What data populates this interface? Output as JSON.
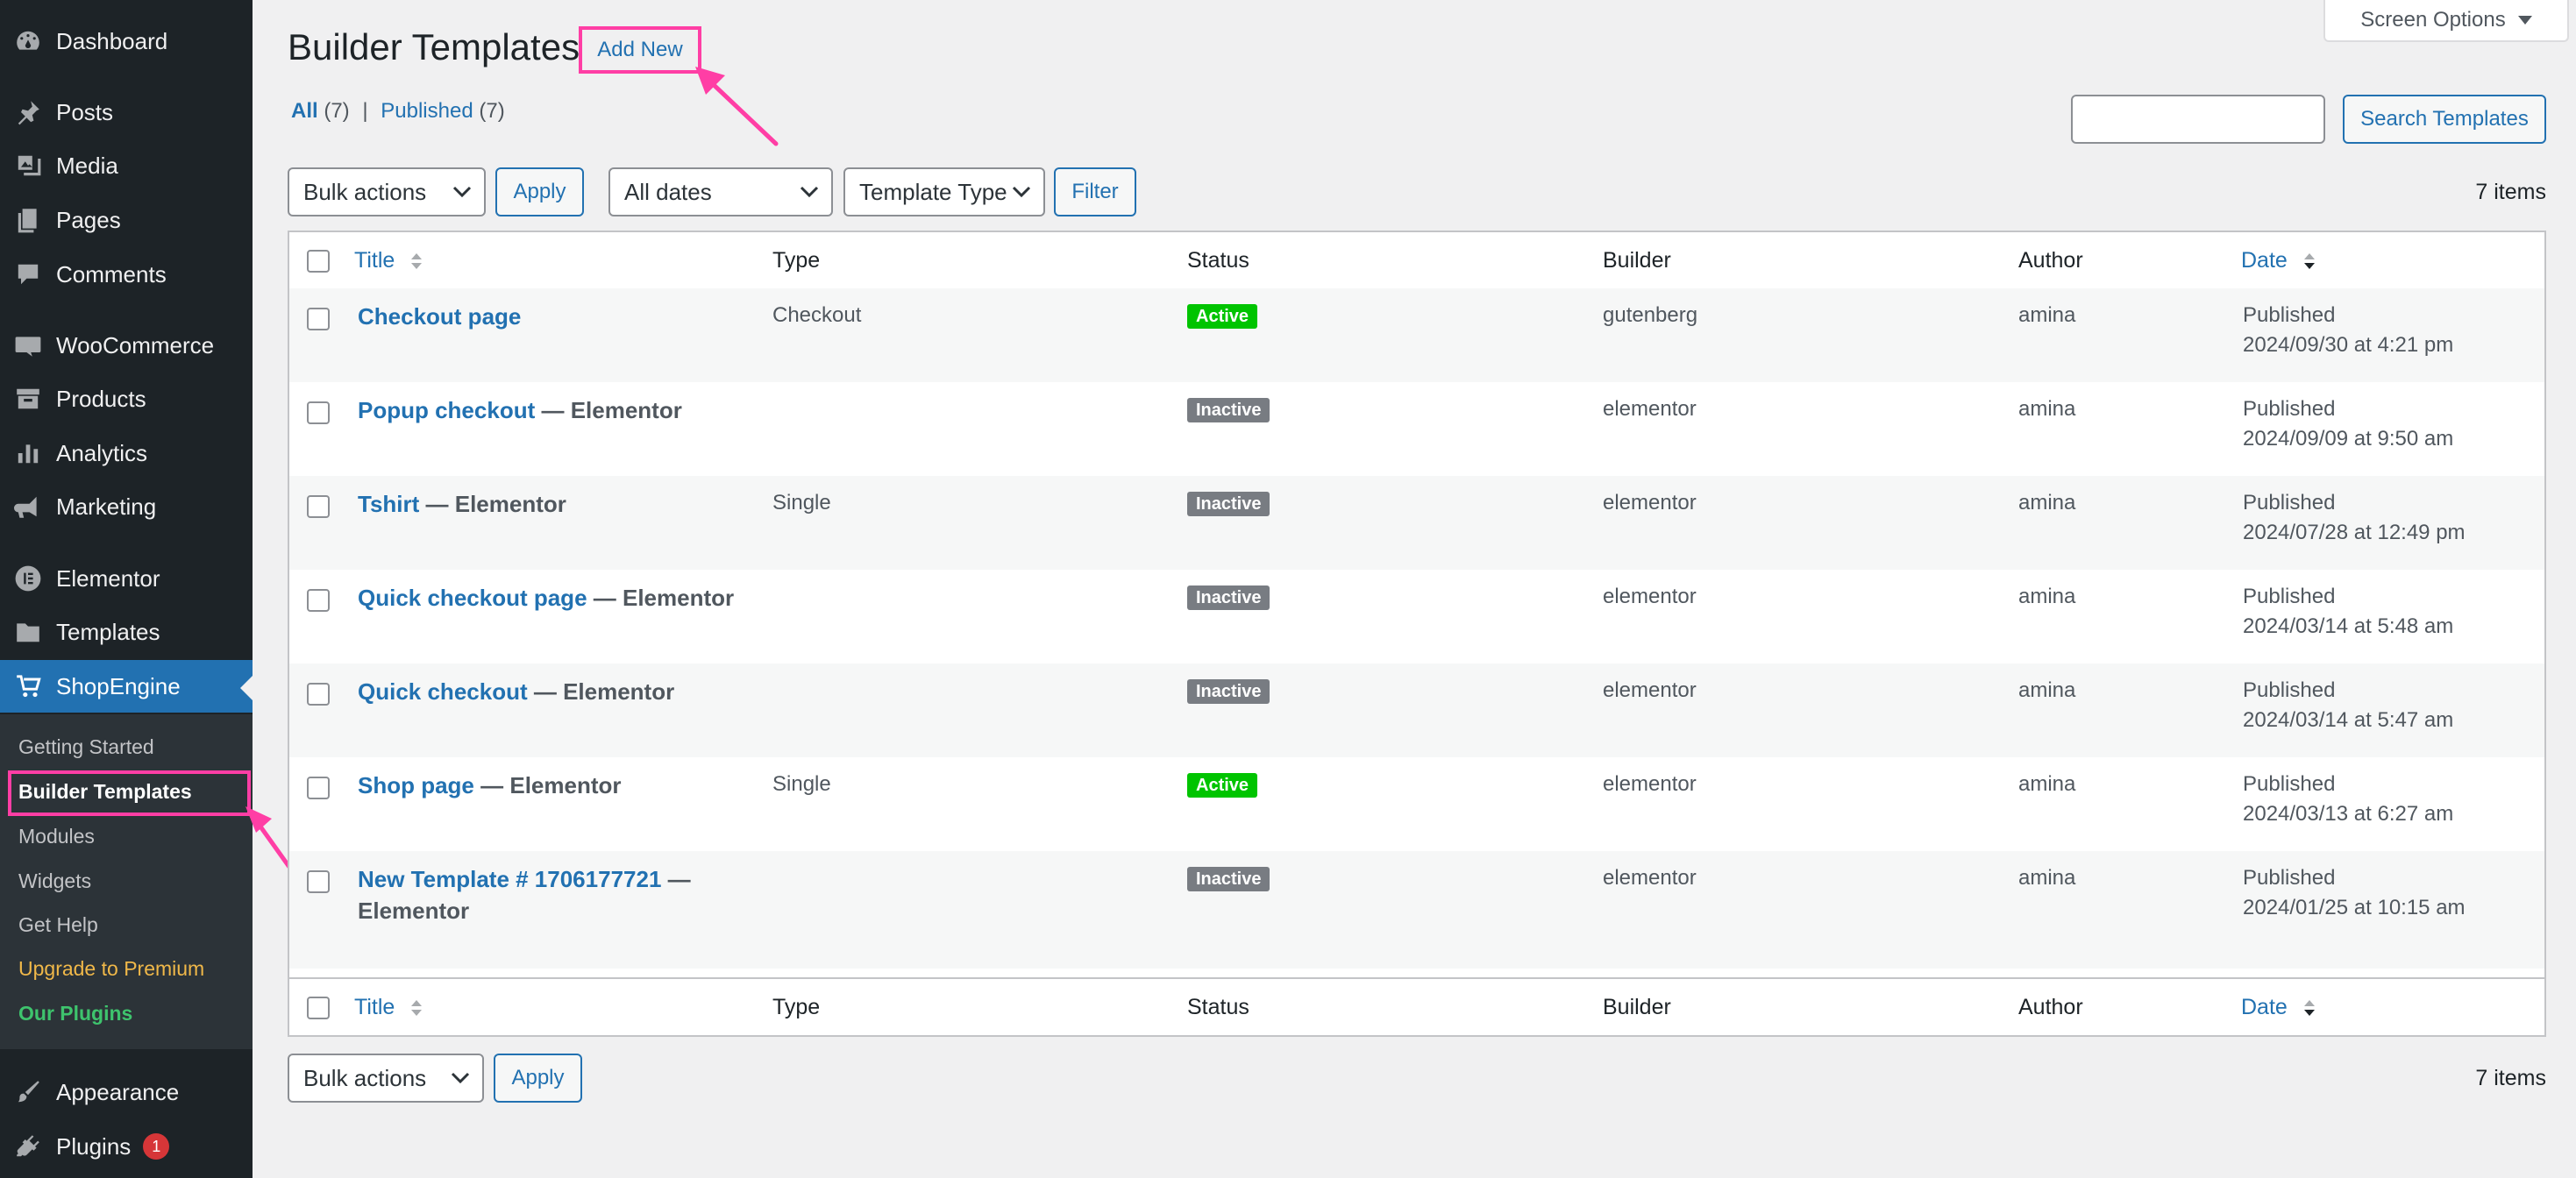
{
  "sidebar": {
    "items": [
      {
        "label": "Dashboard",
        "icon": "dashboard-icon"
      },
      {
        "label": "Posts",
        "icon": "pin-icon"
      },
      {
        "label": "Media",
        "icon": "media-icon"
      },
      {
        "label": "Pages",
        "icon": "pages-icon"
      },
      {
        "label": "Comments",
        "icon": "comment-icon"
      },
      {
        "label": "WooCommerce",
        "icon": "woo-icon"
      },
      {
        "label": "Products",
        "icon": "archive-icon"
      },
      {
        "label": "Analytics",
        "icon": "bar-chart-icon"
      },
      {
        "label": "Marketing",
        "icon": "megaphone-icon"
      },
      {
        "label": "Elementor",
        "icon": "elementor-icon"
      },
      {
        "label": "Templates",
        "icon": "folder-icon"
      },
      {
        "label": "ShopEngine",
        "icon": "shopengine-icon"
      }
    ],
    "submenu": [
      {
        "label": "Getting Started"
      },
      {
        "label": "Builder Templates"
      },
      {
        "label": "Modules"
      },
      {
        "label": "Widgets"
      },
      {
        "label": "Get Help"
      },
      {
        "label": "Upgrade to Premium"
      },
      {
        "label": "Our Plugins"
      }
    ],
    "bottom": [
      {
        "label": "Appearance",
        "icon": "brush-icon"
      },
      {
        "label": "Plugins",
        "icon": "plugin-icon",
        "badge": "1"
      }
    ]
  },
  "header": {
    "title": "Builder Templates",
    "add_new": "Add New",
    "screen_options": "Screen Options"
  },
  "views": {
    "all_label": "All",
    "all_count": "(7)",
    "separator": "|",
    "published_label": "Published",
    "published_count": "(7)"
  },
  "search": {
    "value": "",
    "button": "Search Templates"
  },
  "filters": {
    "bulk_actions": "Bulk actions",
    "apply": "Apply",
    "dates": "All dates",
    "template_type": "Template Type",
    "filter": "Filter",
    "items_count": "7 items"
  },
  "table": {
    "columns": {
      "title": "Title",
      "type": "Type",
      "status": "Status",
      "builder": "Builder",
      "author": "Author",
      "date": "Date"
    },
    "rows": [
      {
        "title": "Checkout page",
        "suffix": "",
        "type": "Checkout",
        "status": "Active",
        "builder": "gutenberg",
        "author": "amina",
        "date_status": "Published",
        "date": "2024/09/30 at 4:21 pm"
      },
      {
        "title": "Popup checkout",
        "suffix": " — Elementor",
        "type": "",
        "status": "Inactive",
        "builder": "elementor",
        "author": "amina",
        "date_status": "Published",
        "date": "2024/09/09 at 9:50 am"
      },
      {
        "title": "Tshirt",
        "suffix": " — Elementor",
        "type": "Single",
        "status": "Inactive",
        "builder": "elementor",
        "author": "amina",
        "date_status": "Published",
        "date": "2024/07/28 at 12:49 pm"
      },
      {
        "title": "Quick checkout page",
        "suffix": " — Elementor",
        "type": "",
        "status": "Inactive",
        "builder": "elementor",
        "author": "amina",
        "date_status": "Published",
        "date": "2024/03/14 at 5:48 am"
      },
      {
        "title": "Quick checkout",
        "suffix": " — Elementor",
        "type": "",
        "status": "Inactive",
        "builder": "elementor",
        "author": "amina",
        "date_status": "Published",
        "date": "2024/03/14 at 5:47 am"
      },
      {
        "title": "Shop page",
        "suffix": " — Elementor",
        "type": "Single",
        "status": "Active",
        "builder": "elementor",
        "author": "amina",
        "date_status": "Published",
        "date": "2024/03/13 at 6:27 am"
      },
      {
        "title": "New Template # 1706177721",
        "suffix": " — Elementor",
        "type": "",
        "status": "Inactive",
        "builder": "elementor",
        "author": "amina",
        "date_status": "Published",
        "date": "2024/01/25 at 10:15 am"
      }
    ]
  },
  "colors": {
    "sidebar_bg": "#1d2327",
    "submenu_bg": "#2c3338",
    "accent": "#2271b1",
    "active_badge": "#00c400",
    "inactive_badge": "#787c82",
    "highlight": "#ff3ea5"
  }
}
